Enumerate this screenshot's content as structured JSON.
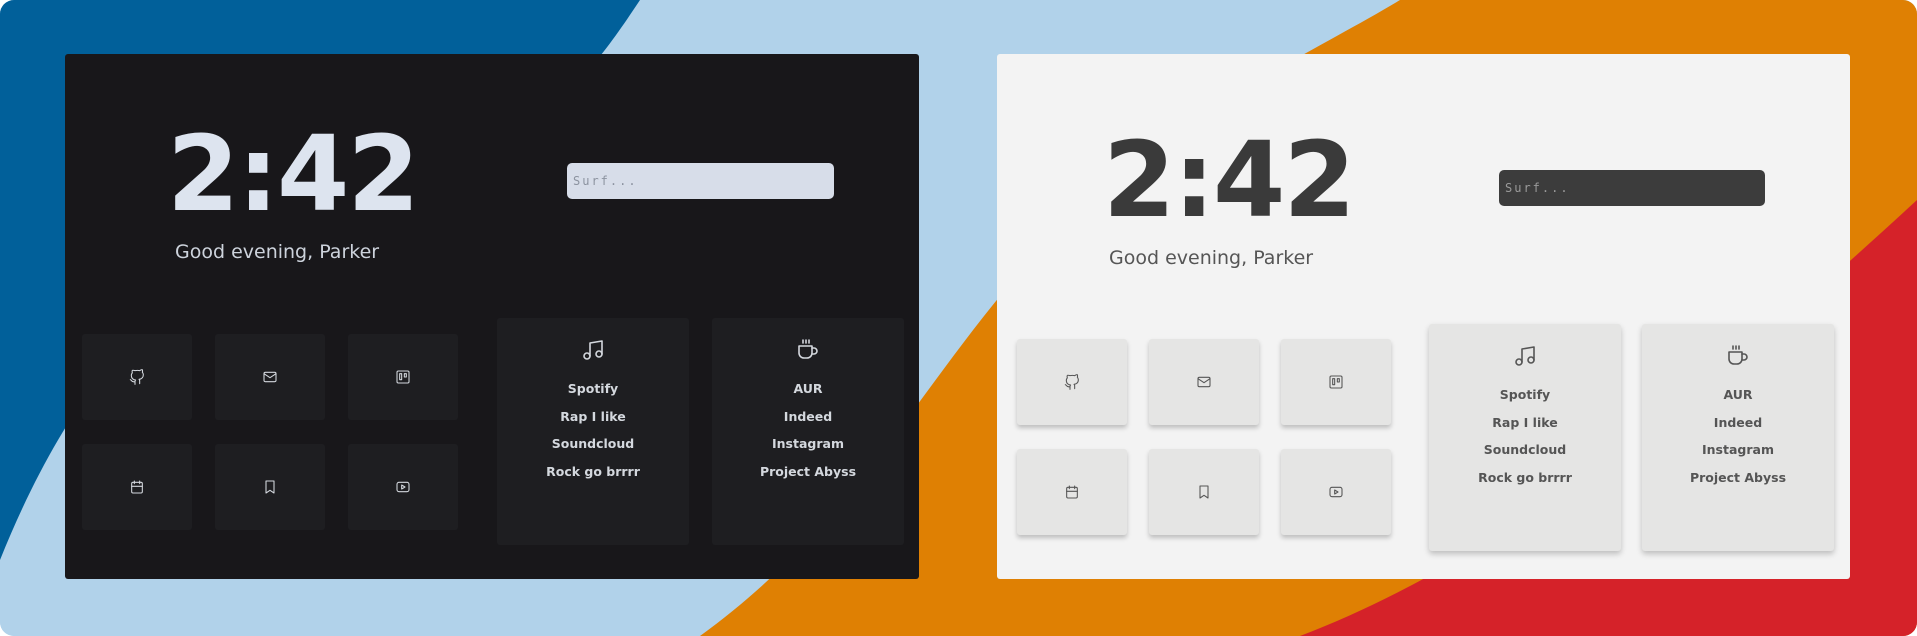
{
  "colors": {
    "dark_panel": "#18171a",
    "light_panel": "#f3f3f3",
    "bg_blue": "#01609a",
    "bg_orange": "#df8003",
    "bg_red": "#d52229",
    "bg_light_blue": "#b1d2ea"
  },
  "dark": {
    "time": "2:42",
    "greeting": "Good evening, Parker",
    "search": {
      "placeholder": "Surf..."
    },
    "tiles": [
      {
        "icon": "github-icon"
      },
      {
        "icon": "mail-icon"
      },
      {
        "icon": "trello-icon"
      },
      {
        "icon": "calendar-icon"
      },
      {
        "icon": "bookmark-icon"
      },
      {
        "icon": "youtube-icon"
      }
    ],
    "cards": [
      {
        "icon": "music-icon",
        "links": [
          "Spotify",
          "Rap I like",
          "Soundcloud",
          "Rock go brrrr"
        ]
      },
      {
        "icon": "coffee-icon",
        "links": [
          "AUR",
          "Indeed",
          "Instagram",
          "Project Abyss"
        ]
      }
    ]
  },
  "light": {
    "time": "2:42",
    "greeting": "Good evening, Parker",
    "search": {
      "placeholder": "Surf..."
    },
    "tiles": [
      {
        "icon": "github-icon"
      },
      {
        "icon": "mail-icon"
      },
      {
        "icon": "trello-icon"
      },
      {
        "icon": "calendar-icon"
      },
      {
        "icon": "bookmark-icon"
      },
      {
        "icon": "youtube-icon"
      }
    ],
    "cards": [
      {
        "icon": "music-icon",
        "links": [
          "Spotify",
          "Rap I like",
          "Soundcloud",
          "Rock go brrrr"
        ]
      },
      {
        "icon": "coffee-icon",
        "links": [
          "AUR",
          "Indeed",
          "Instagram",
          "Project Abyss"
        ]
      }
    ]
  }
}
